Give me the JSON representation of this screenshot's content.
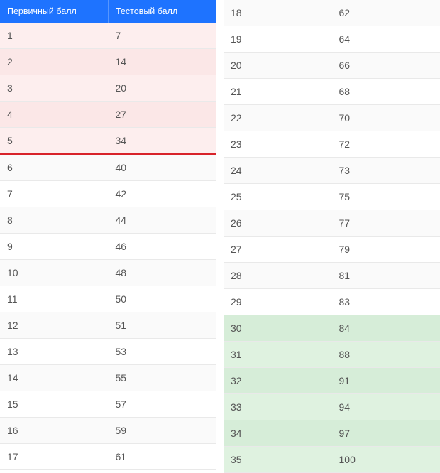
{
  "headers": {
    "primary": "Первичный балл",
    "test": "Тестовый балл"
  },
  "left_rows": [
    {
      "p": "1",
      "t": "7",
      "cls": "pink"
    },
    {
      "p": "2",
      "t": "14",
      "cls": "pink alt"
    },
    {
      "p": "3",
      "t": "20",
      "cls": "pink"
    },
    {
      "p": "4",
      "t": "27",
      "cls": "pink alt"
    },
    {
      "p": "5",
      "t": "34",
      "cls": "pink redline"
    },
    {
      "p": "6",
      "t": "40",
      "cls": "alt"
    },
    {
      "p": "7",
      "t": "42",
      "cls": ""
    },
    {
      "p": "8",
      "t": "44",
      "cls": "alt"
    },
    {
      "p": "9",
      "t": "46",
      "cls": ""
    },
    {
      "p": "10",
      "t": "48",
      "cls": "alt"
    },
    {
      "p": "11",
      "t": "50",
      "cls": ""
    },
    {
      "p": "12",
      "t": "51",
      "cls": "alt"
    },
    {
      "p": "13",
      "t": "53",
      "cls": ""
    },
    {
      "p": "14",
      "t": "55",
      "cls": "alt"
    },
    {
      "p": "15",
      "t": "57",
      "cls": ""
    },
    {
      "p": "16",
      "t": "59",
      "cls": "alt"
    },
    {
      "p": "17",
      "t": "61",
      "cls": ""
    }
  ],
  "right_rows": [
    {
      "p": "18",
      "t": "62",
      "cls": "alt"
    },
    {
      "p": "19",
      "t": "64",
      "cls": ""
    },
    {
      "p": "20",
      "t": "66",
      "cls": "alt"
    },
    {
      "p": "21",
      "t": "68",
      "cls": ""
    },
    {
      "p": "22",
      "t": "70",
      "cls": "alt"
    },
    {
      "p": "23",
      "t": "72",
      "cls": ""
    },
    {
      "p": "24",
      "t": "73",
      "cls": "alt"
    },
    {
      "p": "25",
      "t": "75",
      "cls": ""
    },
    {
      "p": "26",
      "t": "77",
      "cls": "alt"
    },
    {
      "p": "27",
      "t": "79",
      "cls": ""
    },
    {
      "p": "28",
      "t": "81",
      "cls": "alt"
    },
    {
      "p": "29",
      "t": "83",
      "cls": ""
    },
    {
      "p": "30",
      "t": "84",
      "cls": "green alt"
    },
    {
      "p": "31",
      "t": "88",
      "cls": "green"
    },
    {
      "p": "32",
      "t": "91",
      "cls": "green alt"
    },
    {
      "p": "33",
      "t": "94",
      "cls": "green"
    },
    {
      "p": "34",
      "t": "97",
      "cls": "green alt"
    },
    {
      "p": "35",
      "t": "100",
      "cls": "green"
    }
  ]
}
